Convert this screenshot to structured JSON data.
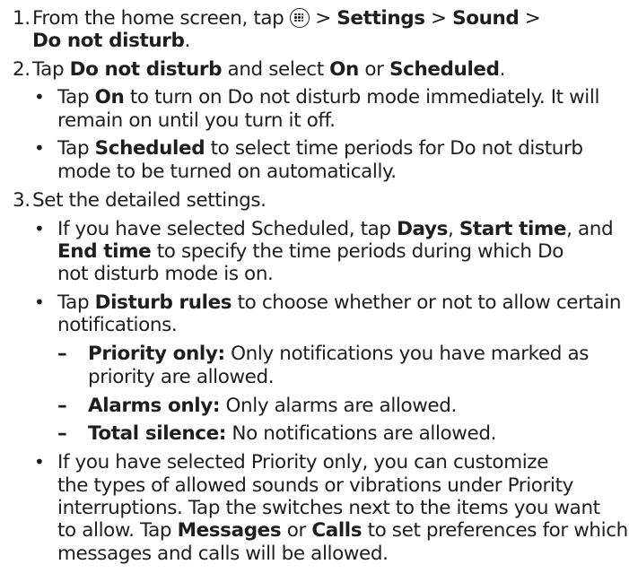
{
  "steps": [
    {
      "number": "1.",
      "line1": {
        "t1": "From the home screen, tap ",
        "icon": "apps-icon",
        "t2": " > ",
        "settings": "Settings",
        "t3": " > ",
        "sound": "Sound",
        "t4": " >"
      },
      "line2": {
        "dnd": "Do not disturb",
        "t5": "."
      }
    },
    {
      "number": "2.",
      "t1": "Tap ",
      "dnd": "Do not disturb",
      "t2": " and select ",
      "on": "On",
      "t3": " or ",
      "scheduled": "Scheduled",
      "t4": ".",
      "bullets": [
        {
          "line1": {
            "t1": "Tap ",
            "b1": "On",
            "t2": " to turn on Do not disturb mode immediately. It will"
          },
          "line2": "remain on until you turn it off."
        },
        {
          "line1": {
            "t1": "Tap ",
            "b1": "Scheduled",
            "t2": " to select time periods for Do not disturb"
          },
          "line2": "mode to be turned on automatically."
        }
      ]
    },
    {
      "number": "3.",
      "text": "Set the detailed settings.",
      "bullets": [
        {
          "line1": {
            "t1": "If you have selected Scheduled, tap ",
            "days": "Days",
            "c1": ", ",
            "start": "Start time",
            "c2": ", and"
          },
          "line2": {
            "end": "End time",
            "t2": " to specify the time periods during which Do"
          },
          "line3": "not disturb mode is on."
        },
        {
          "line1": {
            "t1": "Tap ",
            "b1": "Disturb rules",
            "t2": " to choose whether or not to allow certain"
          },
          "line2": "notifications.",
          "subitems": [
            {
              "dash": "–",
              "label": "Priority only:",
              "text": " Only notifications you have marked as",
              "line2": "priority are allowed."
            },
            {
              "dash": "–",
              "label": "Alarms only:",
              "text": " Only alarms are allowed."
            },
            {
              "dash": "–",
              "label": "Total silence:",
              "text": " No notifications are allowed."
            }
          ]
        },
        {
          "line1": "If you have selected Priority only, you can customize",
          "line2": "the types of allowed sounds or vibrations under Priority",
          "line3": "interruptions. Tap the switches next to the items you want",
          "line4": {
            "t1": "to allow. Tap ",
            "messages": "Messages",
            "t2": " or ",
            "calls": "Calls",
            "t3": " to set preferences for which"
          },
          "line5": "messages and calls will be allowed."
        }
      ]
    }
  ],
  "bullet_char": "•"
}
